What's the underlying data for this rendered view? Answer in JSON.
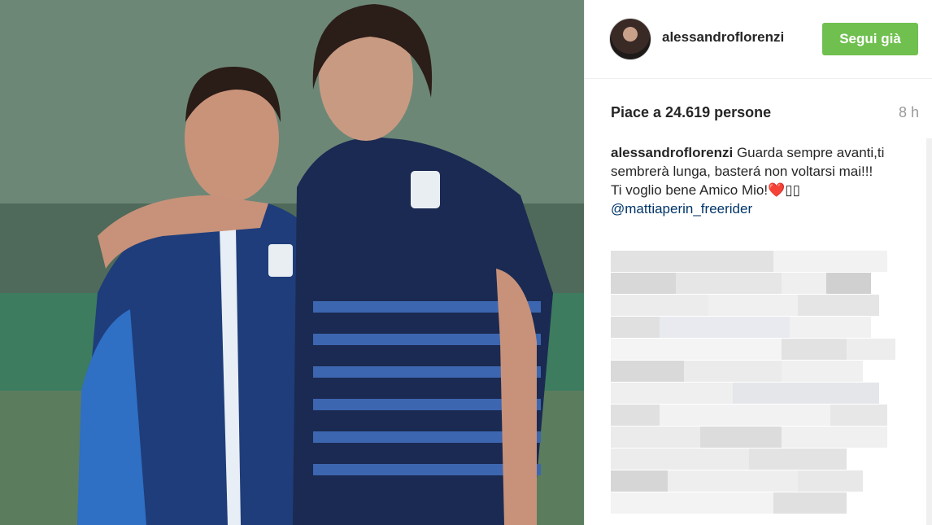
{
  "post": {
    "username": "alessandroflorenzi",
    "follow_label": "Segui già",
    "likes_text": "Piace a 24.619 persone",
    "time_ago": "8 h",
    "caption": {
      "username": "alessandroflorenzi",
      "text_line1": "Guarda sempre avanti,ti sembrerà lunga, basterá non voltarsi mai!!!",
      "text_line2": "Ti voglio bene Amico Mio!❤️▯▯",
      "mention": "@mattiaperin_freerider"
    }
  },
  "colors": {
    "follow_button": "#70c050",
    "text": "#262626",
    "muted": "#999999",
    "mention": "#003569"
  },
  "icons": {
    "avatar": "profile-avatar"
  }
}
